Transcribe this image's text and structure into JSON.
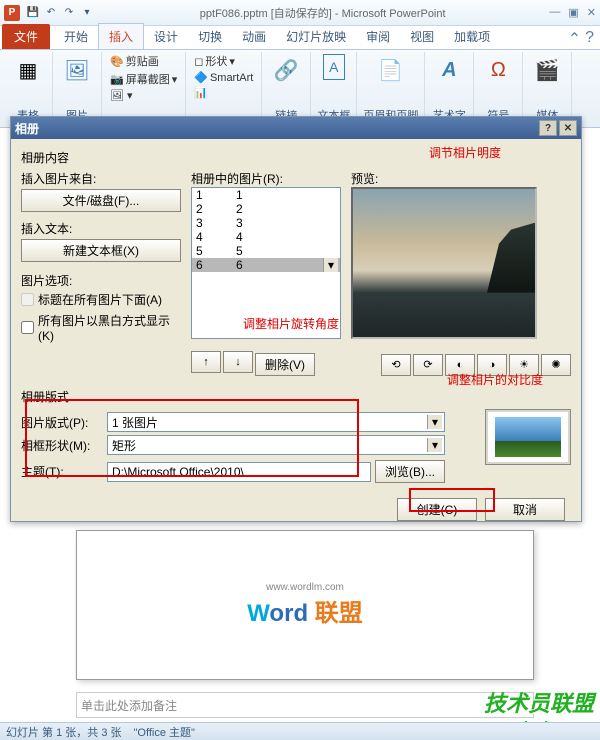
{
  "titlebar": {
    "filename": "pptF086.pptm [自动保存的]",
    "app": "Microsoft PowerPoint"
  },
  "tabs": {
    "file": "文件",
    "home": "开始",
    "insert": "插入",
    "design": "设计",
    "transitions": "切换",
    "animations": "动画",
    "slideshow": "幻灯片放映",
    "review": "审阅",
    "view": "视图",
    "addins": "加载项"
  },
  "ribbon": {
    "tables": "表格",
    "images": "图片",
    "clipart": "剪贴画",
    "screenshot": "屏幕截图",
    "shapes": "形状",
    "smartart": "SmartArt",
    "links": "链接",
    "textbox": "文本框",
    "headerfooter": "页眉和页脚",
    "wordart": "艺术字",
    "symbols": "符号",
    "media": "媒体"
  },
  "dialog": {
    "title": "相册",
    "album_content": "相册内容",
    "insert_from": "插入图片来自:",
    "file_disk": "文件/磁盘(F)...",
    "insert_text": "插入文本:",
    "new_textbox": "新建文本框(X)",
    "pic_options": "图片选项:",
    "caption_below": "标题在所有图片下面(A)",
    "all_bw": "所有图片以黑白方式显示(K)",
    "pics_in_album": "相册中的图片(R):",
    "preview": "预览:",
    "list": [
      [
        "1",
        "1"
      ],
      [
        "2",
        "2"
      ],
      [
        "3",
        "3"
      ],
      [
        "4",
        "4"
      ],
      [
        "5",
        "5"
      ],
      [
        "6",
        "6"
      ]
    ],
    "remove": "删除(V)",
    "album_layout": "相册版式",
    "pic_layout": "图片版式(P):",
    "pic_layout_val": "1 张图片",
    "frame_shape": "相框形状(M):",
    "frame_shape_val": "矩形",
    "theme": "主题(T):",
    "theme_val": "D:\\Microsoft Office\\2010\\",
    "browse": "浏览(B)...",
    "create": "创建(C)",
    "cancel": "取消",
    "note_brightness": "调节相片明度",
    "note_rotation": "调整相片旋转角度",
    "note_contrast": "调整相片的对比度"
  },
  "slide": {
    "wordlm_domain": "www.wordlm.com",
    "word": "Word",
    "lm": "联盟"
  },
  "notes_placeholder": "单击此处添加备注",
  "status": {
    "slide": "幻灯片 第 1 张，共 3 张",
    "theme": "\"Office 主题\""
  },
  "watermark": {
    "l1": "技术员联盟",
    "l2": "www.jsgho.com"
  }
}
